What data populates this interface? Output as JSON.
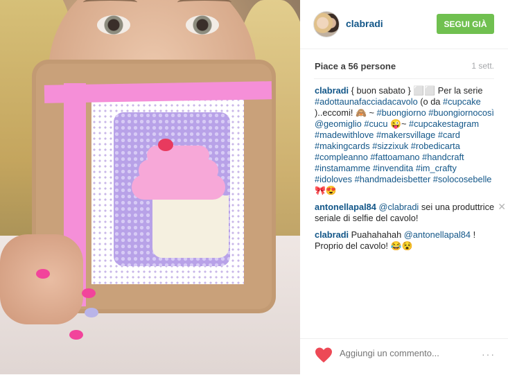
{
  "header": {
    "username": "clabradi",
    "follow_label": "SEGUI GIÀ"
  },
  "likes": "Piace a 56 persone",
  "time": "1 sett.",
  "comments": [
    {
      "user": "clabradi",
      "parts": [
        {
          "t": " { buon sabato } "
        },
        {
          "t": "⬜⬜"
        },
        {
          "t": " Per la serie "
        },
        {
          "t": "#adottaunafacciadacavolo",
          "tag": true
        },
        {
          "t": " (o da "
        },
        {
          "t": "#cupcake",
          "tag": true
        },
        {
          "t": " )..eccomi! 🙈 ~ "
        },
        {
          "t": "#buongiorno",
          "tag": true
        },
        {
          "t": " "
        },
        {
          "t": "#buongiornocosì",
          "tag": true
        },
        {
          "t": " "
        },
        {
          "t": "@geomiglio",
          "tag": true
        },
        {
          "t": " "
        },
        {
          "t": "#cucu",
          "tag": true
        },
        {
          "t": " 😜~ "
        },
        {
          "t": "#cupcakestagram",
          "tag": true
        },
        {
          "t": " "
        },
        {
          "t": "#madewithlove",
          "tag": true
        },
        {
          "t": " "
        },
        {
          "t": "#makersvillage",
          "tag": true
        },
        {
          "t": " "
        },
        {
          "t": "#card",
          "tag": true
        },
        {
          "t": " "
        },
        {
          "t": "#makingcards",
          "tag": true
        },
        {
          "t": " "
        },
        {
          "t": "#sizzixuk",
          "tag": true
        },
        {
          "t": " "
        },
        {
          "t": "#robedicarta",
          "tag": true
        },
        {
          "t": " "
        },
        {
          "t": "#compleanno",
          "tag": true
        },
        {
          "t": " "
        },
        {
          "t": "#fattoamano",
          "tag": true
        },
        {
          "t": " "
        },
        {
          "t": "#handcraft",
          "tag": true
        },
        {
          "t": " "
        },
        {
          "t": "#instamamme",
          "tag": true
        },
        {
          "t": " "
        },
        {
          "t": "#invendita",
          "tag": true
        },
        {
          "t": " "
        },
        {
          "t": "#im_crafty",
          "tag": true
        },
        {
          "t": " "
        },
        {
          "t": "#idoloves",
          "tag": true
        },
        {
          "t": " "
        },
        {
          "t": "#handmadeisbetter",
          "tag": true
        },
        {
          "t": " "
        },
        {
          "t": "#solocosebelle",
          "tag": true
        },
        {
          "t": " 🎀😍"
        }
      ]
    },
    {
      "user": "antonellapal84",
      "removable": true,
      "parts": [
        {
          "t": " "
        },
        {
          "t": "@clabradi",
          "tag": true
        },
        {
          "t": " sei una produttrice seriale di selfie del cavolo!"
        }
      ]
    },
    {
      "user": "clabradi",
      "parts": [
        {
          "t": " Puahahahah "
        },
        {
          "t": "@antonellapal84",
          "tag": true
        },
        {
          "t": " ! Proprio del cavolo! 😂😵"
        }
      ]
    }
  ],
  "footer": {
    "add_comment_placeholder": "Aggiungi un commento...",
    "more_label": "···"
  },
  "colors": {
    "link": "#125688",
    "follow_green": "#70c050",
    "heart_red": "#ed4956"
  }
}
